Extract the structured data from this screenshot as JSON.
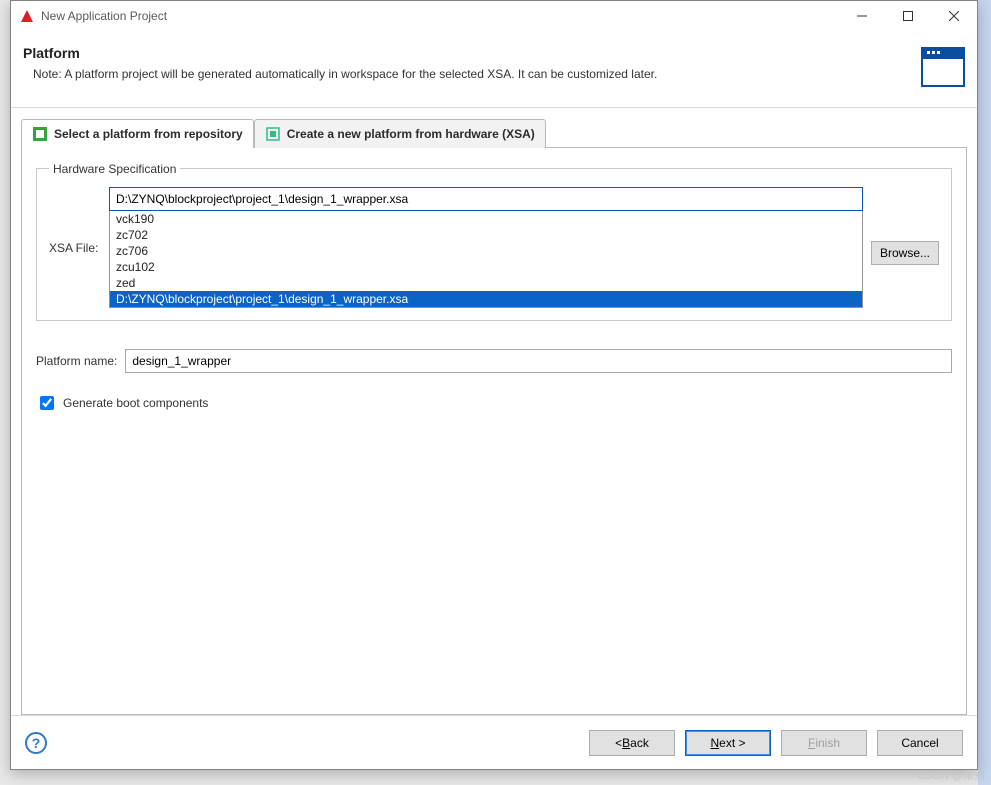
{
  "window": {
    "title": "New Application Project",
    "min": "—",
    "max": "☐",
    "close": "✕"
  },
  "banner": {
    "title": "Platform",
    "note": "Note: A platform project will be generated automatically in workspace for the selected XSA. It can be customized later."
  },
  "tabs": {
    "repo": "Select a platform from repository",
    "xsa": "Create a new platform from hardware (XSA)"
  },
  "hw": {
    "legend": "Hardware Specification",
    "label": "XSA File:",
    "input_value": "D:\\ZYNQ\\blockproject\\project_1\\design_1_wrapper.xsa",
    "options": [
      "vck190",
      "zc702",
      "zc706",
      "zcu102",
      "zed",
      "D:\\ZYNQ\\blockproject\\project_1\\design_1_wrapper.xsa"
    ],
    "selected_index": 5,
    "browse": "Browse..."
  },
  "platform": {
    "label": "Platform name:",
    "value": "design_1_wrapper"
  },
  "checkbox": {
    "label": "Generate boot components",
    "checked": true
  },
  "footer": {
    "back": "Back",
    "next": "Next >",
    "finish": "Finish",
    "cancel": "Cancel"
  },
  "watermark": "CSDN @宋别"
}
